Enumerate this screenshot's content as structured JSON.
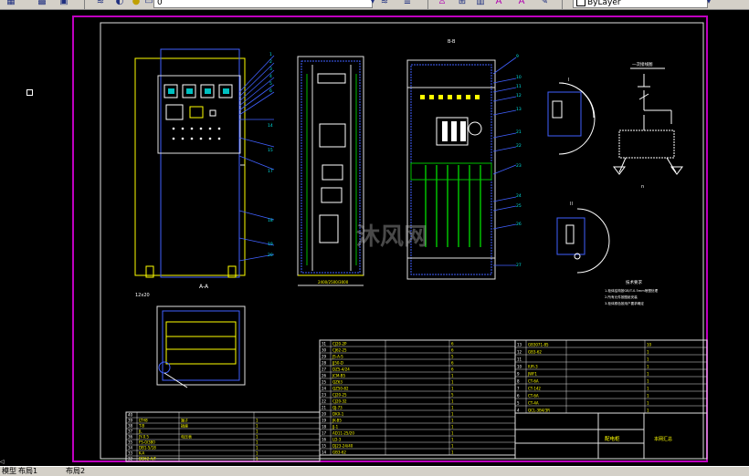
{
  "toolbar": {
    "layer_value": "0",
    "linetype_value": "ByLayer",
    "icons": [
      "layers-icon",
      "match-icon",
      "layer-state-icon",
      "layer-prev-icon",
      "layer-icon-2",
      "text-style-icon",
      "text-A-icon",
      "text-AI-icon",
      "text-find-icon"
    ]
  },
  "drawing": {
    "section_a_label": "A-A",
    "section_b_label": "B-B",
    "dim_label": "12x20",
    "notes_title": "技术要求",
    "notes": [
      "1.柜体结构按GB/T-0.5mm喷塑处理",
      "2.所有元件按图纸安装",
      "3.柜体颜色按用户要求确定"
    ],
    "diagram_title": "一次接线图",
    "table_title": "配电柜",
    "company": "本网汇总"
  },
  "parts_left": [
    {
      "no": "40",
      "name": "",
      "spec": "",
      "qty": ""
    },
    {
      "no": "39",
      "name": "LTH8",
      "spec": "端子",
      "qty": "1"
    },
    {
      "no": "38",
      "name": "T-B",
      "spec": "插座",
      "qty": "1"
    },
    {
      "no": "37",
      "name": "JL",
      "spec": "",
      "qty": "1"
    },
    {
      "no": "36",
      "name": "JY-0.5",
      "spec": "电压表",
      "qty": "1"
    },
    {
      "no": "35",
      "name": "FS-0/380",
      "spec": "",
      "qty": "1"
    },
    {
      "no": "34",
      "name": "DB1-5/18",
      "spec": "",
      "qty": "1"
    },
    {
      "no": "33",
      "name": "K-A",
      "spec": "",
      "qty": "1"
    },
    {
      "no": "32",
      "name": "DD62-A/F",
      "spec": "",
      "qty": "1"
    }
  ],
  "parts_mid": [
    {
      "no": "31",
      "name": "CJ20-2P",
      "spec": "",
      "qty": "6"
    },
    {
      "no": "30",
      "name": "CJ62-25",
      "spec": "",
      "qty": "6"
    },
    {
      "no": "29",
      "name": "JS-A-S",
      "spec": "",
      "qty": "5"
    },
    {
      "no": "28",
      "name": "JJ50-D",
      "spec": "",
      "qty": "6"
    },
    {
      "no": "27",
      "name": "DZ5-4/24",
      "spec": "",
      "qty": "6"
    },
    {
      "no": "26",
      "name": "JCM-B5",
      "spec": "",
      "qty": "1"
    },
    {
      "no": "25",
      "name": "QZ63",
      "spec": "",
      "qty": "1"
    },
    {
      "no": "24",
      "name": "QZ50-82",
      "spec": "",
      "qty": "1"
    },
    {
      "no": "23",
      "name": "CJ20-25",
      "spec": "",
      "qty": "5"
    },
    {
      "no": "22",
      "name": "CJ20-32",
      "spec": "",
      "qty": "1"
    },
    {
      "no": "21",
      "name": "QJ-73",
      "spec": "",
      "qty": "1"
    },
    {
      "no": "20",
      "name": "DKX-1",
      "spec": "",
      "qty": "1"
    },
    {
      "no": "19",
      "name": "JK-B5",
      "spec": "",
      "qty": "1"
    },
    {
      "no": "18",
      "name": "JJ-1",
      "spec": "",
      "qty": "1"
    },
    {
      "no": "17",
      "name": "AD11-25/20",
      "spec": "",
      "qty": "1"
    },
    {
      "no": "16",
      "name": "LD-3",
      "spec": "",
      "qty": "1"
    },
    {
      "no": "15",
      "name": "DJ23-24/40",
      "spec": "",
      "qty": "1"
    },
    {
      "no": "14",
      "name": "GB3-62",
      "spec": "",
      "qty": "1"
    }
  ],
  "parts_right": [
    {
      "no": "13",
      "name": "GB3071-85",
      "spec": "",
      "qty": "10"
    },
    {
      "no": "12",
      "name": "GB3-62",
      "spec": "",
      "qty": "1"
    },
    {
      "no": "11",
      "name": "",
      "spec": "",
      "qty": "1"
    },
    {
      "no": "10",
      "name": "IUR-3",
      "spec": "",
      "qty": "1"
    },
    {
      "no": "9",
      "name": "JWF1",
      "spec": "",
      "qty": "1"
    },
    {
      "no": "8",
      "name": "CT-6A",
      "spec": "",
      "qty": "1"
    },
    {
      "no": "7",
      "name": "CT-142",
      "spec": "",
      "qty": "1"
    },
    {
      "no": "6",
      "name": "CT-6A",
      "spec": "",
      "qty": "1"
    },
    {
      "no": "5",
      "name": "CT-4A",
      "spec": "",
      "qty": "1"
    },
    {
      "no": "4",
      "name": "QCL-3B4/3R",
      "spec": "",
      "qty": "1"
    }
  ],
  "status": {
    "model_tab": "模型",
    "layout1": "布局1",
    "layout2": "布局2"
  },
  "watermark": "沐风网",
  "colors": {
    "canvas": "#000000",
    "border": "#c000c0",
    "frame": "#ffffff",
    "outline": "#4060ff",
    "text": "#ffff00",
    "cyan": "#00e0e0",
    "green": "#00c000"
  }
}
